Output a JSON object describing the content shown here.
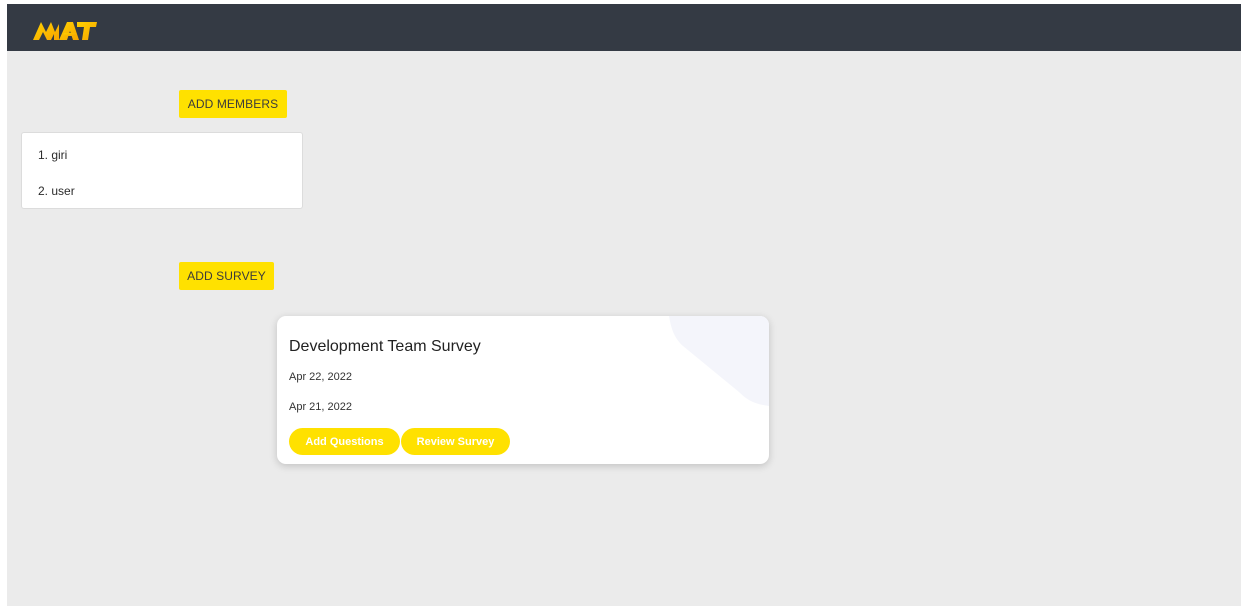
{
  "header": {
    "logo_text": "MAT",
    "background_color": "#343a44",
    "logo_color": "#ffc400"
  },
  "members": {
    "add_button_label": "ADD MEMBERS",
    "items": [
      {
        "label": "1. giri"
      },
      {
        "label": "2. user"
      }
    ]
  },
  "surveys": {
    "add_button_label": "ADD SURVEY",
    "cards": [
      {
        "title": "Development Team Survey",
        "date_1": "Apr 22, 2022",
        "date_2": "Apr 21, 2022",
        "add_questions_label": "Add Questions",
        "review_survey_label": "Review Survey"
      }
    ]
  },
  "colors": {
    "accent_yellow": "#ffe100",
    "page_background": "#ebebeb"
  }
}
